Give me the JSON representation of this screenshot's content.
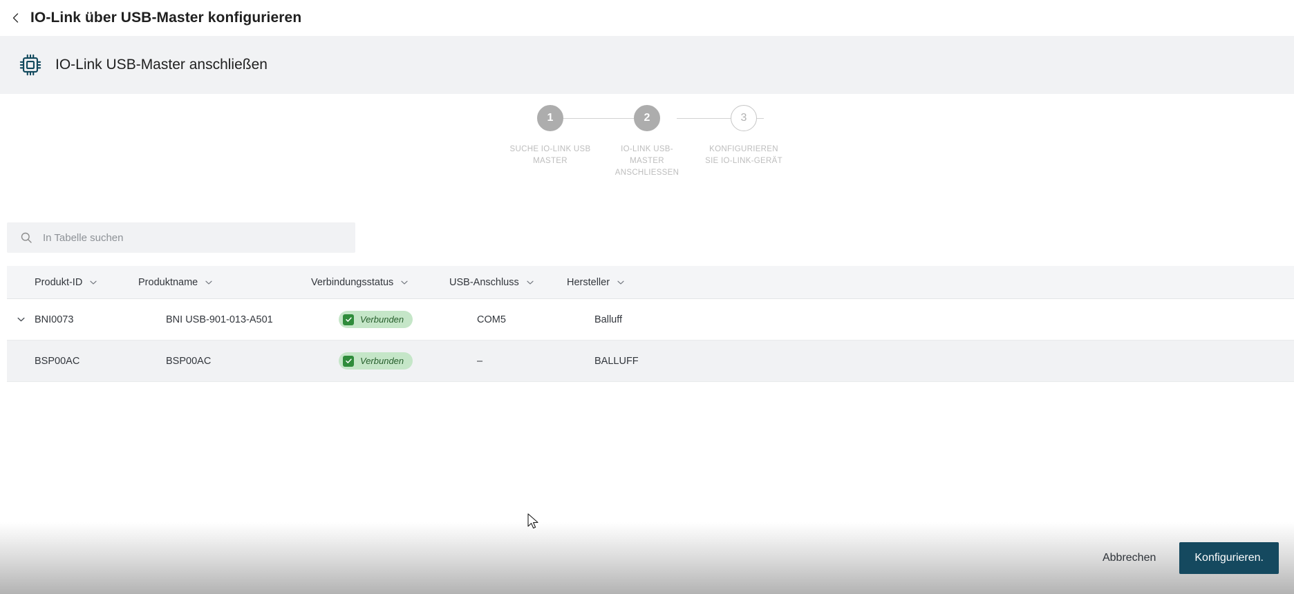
{
  "titlebar": {
    "back_icon": "chevron-left-icon",
    "title": "IO-Link über USB-Master konfigurieren"
  },
  "banner": {
    "icon": "chip-icon",
    "title": "IO-Link USB-Master anschließen"
  },
  "stepper": {
    "steps": [
      {
        "number": "1",
        "label": "SUCHE IO-LINK USB MASTER",
        "state": "filled"
      },
      {
        "number": "2",
        "label": "IO-LINK USB-MASTER ANSCHLIESSEN",
        "state": "filled"
      },
      {
        "number": "3",
        "label": "KONFIGURIEREN SIE IO-LINK-GERÄT",
        "state": "outline"
      }
    ]
  },
  "search": {
    "icon": "search-icon",
    "placeholder": "In Tabelle suchen",
    "value": ""
  },
  "table": {
    "columns": [
      {
        "label": "Produkt-ID"
      },
      {
        "label": "Produktname"
      },
      {
        "label": "Verbindungsstatus"
      },
      {
        "label": "USB-Anschluss"
      },
      {
        "label": "Hersteller"
      }
    ],
    "rows": [
      {
        "expandable": true,
        "product_id": "BNI0073",
        "product_name": "BNI USB-901-013-A501",
        "status": "Verbunden",
        "usb_port": "COM5",
        "vendor": "Balluff"
      },
      {
        "expandable": false,
        "product_id": "BSP00AC",
        "product_name": "BSP00AC",
        "status": "Verbunden",
        "usb_port": "–",
        "vendor": "BALLUFF"
      }
    ]
  },
  "footer": {
    "cancel_label": "Abbrechen",
    "primary_label": "Konfigurieren."
  },
  "colors": {
    "primary_button": "#15495f",
    "banner_bg": "#f1f2f4",
    "badge_bg": "#c5e6c8",
    "badge_check": "#2f8c3b",
    "badge_text": "#245c2a",
    "step_filled": "#adadad",
    "step_outline_border": "#c6c6c6",
    "icon_teal": "#10485c"
  }
}
